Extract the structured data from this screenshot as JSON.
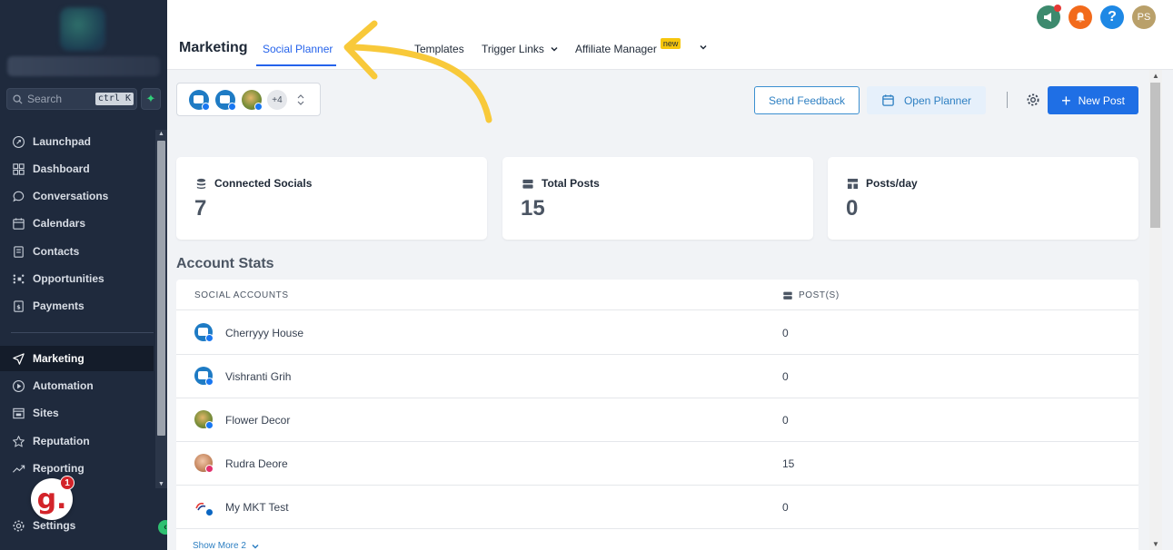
{
  "sidebar": {
    "search_placeholder": "Search",
    "search_shortcut": "ctrl K",
    "items": [
      {
        "label": "Launchpad",
        "icon": "rocket-icon"
      },
      {
        "label": "Dashboard",
        "icon": "grid-icon"
      },
      {
        "label": "Conversations",
        "icon": "chat-icon"
      },
      {
        "label": "Calendars",
        "icon": "calendar-icon"
      },
      {
        "label": "Contacts",
        "icon": "contacts-icon"
      },
      {
        "label": "Opportunities",
        "icon": "filter-icon"
      },
      {
        "label": "Payments",
        "icon": "receipt-icon"
      },
      {
        "label": "Marketing",
        "icon": "send-icon"
      },
      {
        "label": "Automation",
        "icon": "automation-icon"
      },
      {
        "label": "Sites",
        "icon": "sites-icon"
      },
      {
        "label": "Reputation",
        "icon": "star-icon"
      },
      {
        "label": "Reporting",
        "icon": "trend-icon"
      },
      {
        "label": "Settings",
        "icon": "gear-icon"
      }
    ],
    "active_item": "Marketing",
    "notification_badge_letter": "g.",
    "notification_count": "1"
  },
  "header": {
    "title": "Marketing",
    "tabs": [
      {
        "label": "Social Planner",
        "active": true
      },
      {
        "label": "Templates"
      },
      {
        "label": "Trigger Links"
      },
      {
        "label": "Affiliate Manager",
        "badge": "new"
      }
    ],
    "avatar_initials": "PS",
    "help_label": "?"
  },
  "toolbar": {
    "more_accounts": "+4",
    "send_feedback": "Send Feedback",
    "open_planner": "Open Planner",
    "new_post": "New Post"
  },
  "stats": [
    {
      "label": "Connected Socials",
      "value": "7"
    },
    {
      "label": "Total Posts",
      "value": "15"
    },
    {
      "label": "Posts/day",
      "value": "0"
    }
  ],
  "account_stats": {
    "title": "Account Stats",
    "col_accounts": "SOCIAL ACCOUNTS",
    "col_posts": "POST(S)",
    "rows": [
      {
        "name": "Cherryyy House",
        "posts": "0",
        "avatar": "chat",
        "network": "facebook"
      },
      {
        "name": "Vishranti Grih",
        "posts": "0",
        "avatar": "chat",
        "network": "facebook"
      },
      {
        "name": "Flower Decor",
        "posts": "0",
        "avatar": "photo",
        "network": "facebook"
      },
      {
        "name": "Rudra Deore",
        "posts": "15",
        "avatar": "photo2",
        "network": "instagram"
      },
      {
        "name": "My MKT Test",
        "posts": "0",
        "avatar": "logo",
        "network": "linkedin"
      }
    ],
    "show_more": "Show More 2"
  },
  "colors": {
    "sidebar_bg": "#1f2a3d",
    "accent": "#1f6fe5",
    "annotation_arrow": "#f8c93a"
  }
}
